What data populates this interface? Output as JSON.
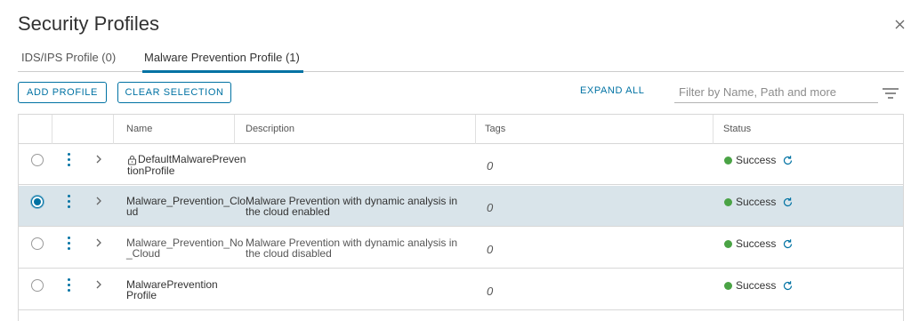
{
  "title": "Security Profiles",
  "tabs": [
    {
      "label": "IDS/IPS Profile (0)",
      "active": false
    },
    {
      "label": "Malware Prevention Profile (1)",
      "active": true
    }
  ],
  "toolbar": {
    "add_label": "ADD PROFILE",
    "clear_label": "CLEAR SELECTION",
    "expand_label": "EXPAND ALL",
    "filter_placeholder": "Filter by Name, Path and more"
  },
  "table": {
    "columns": [
      "Name",
      "Description",
      "Tags",
      "Status"
    ],
    "rows": [
      {
        "name": "DefaultMalwarePreventionProfile",
        "locked": true,
        "description": "",
        "tags": "0",
        "status": "Success",
        "selected": false
      },
      {
        "name": "Malware_Prevention_Cloud",
        "locked": false,
        "description": "Malware Prevention with dynamic analysis in the cloud enabled",
        "tags": "0",
        "status": "Success",
        "selected": true
      },
      {
        "name": "Malware_Prevention_No_Cloud",
        "locked": false,
        "description": "Malware Prevention with dynamic analysis in the cloud disabled",
        "tags": "0",
        "status": "Success",
        "selected": false
      },
      {
        "name": "MalwarePrevention Profile",
        "locked": false,
        "description": "",
        "tags": "0",
        "status": "Success",
        "selected": false
      }
    ]
  },
  "colors": {
    "accent": "#0072a3",
    "success": "#4aa345",
    "selected_row": "#d9e4ea"
  },
  "icons": {
    "close": "close-icon",
    "filter": "filter-icon",
    "kebab": "kebab-menu-icon",
    "expand": "chevron-right-icon",
    "lock": "lock-icon",
    "refresh": "refresh-icon"
  }
}
